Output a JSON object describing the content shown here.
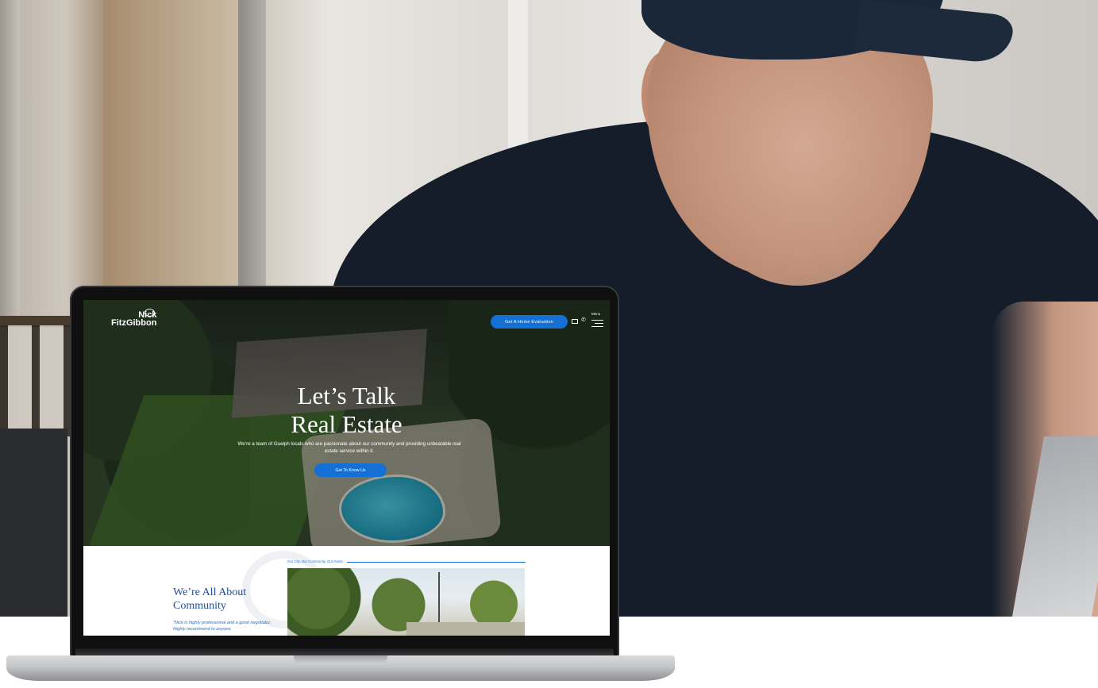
{
  "site": {
    "logo": {
      "line1": "Nick",
      "line2": "FitzGibbon"
    },
    "header": {
      "cta_label": "Get A Home Evaluation",
      "menu_label": "Menu"
    },
    "hero": {
      "title_line1": "Let’s Talk",
      "title_line2": "Real Estate",
      "subtitle": "We’re a team of Guelph locals who are passionate about our community and providing unbeatable real estate service within it.",
      "cta_label": "Get To Know Us"
    },
    "community": {
      "kicker": "Our City. Our Community. Our Home.",
      "title_line1": "We’re All About",
      "title_line2": "Community",
      "quote": "“Nick is highly professional and a good negotiator. Highly recommend to anyone"
    }
  },
  "colors": {
    "accent": "#1470d4",
    "heading_blue": "#1f4f9c"
  },
  "icons": [
    "bubble-icon",
    "mail-icon",
    "phone-icon",
    "hamburger-menu-icon"
  ]
}
